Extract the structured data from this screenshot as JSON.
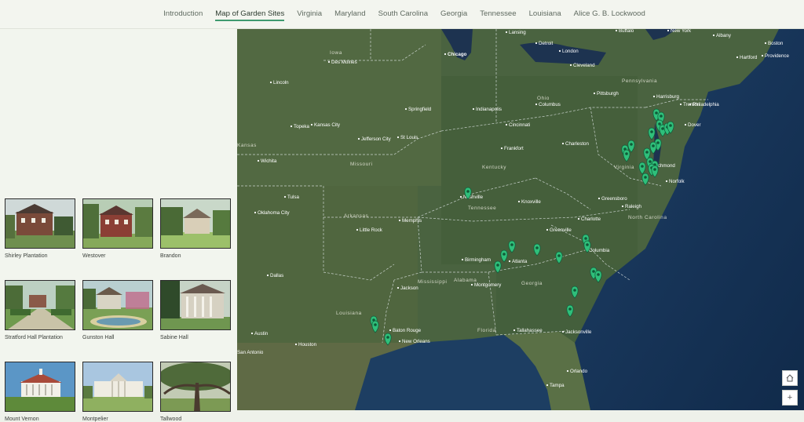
{
  "nav": {
    "tabs": [
      "Introduction",
      "Map of Garden Sites",
      "Virginia",
      "Maryland",
      "South Carolina",
      "Georgia",
      "Tennessee",
      "Louisiana",
      "Alice G. B. Lockwood"
    ],
    "active_index": 1
  },
  "gallery": [
    {
      "caption": "Shirley Plantation"
    },
    {
      "caption": "Westover"
    },
    {
      "caption": "Brandon"
    },
    {
      "caption": "Stratford Hall Plantation"
    },
    {
      "caption": "Gunston Hall"
    },
    {
      "caption": "Sabine Hall"
    },
    {
      "caption": "Mount Vernon"
    },
    {
      "caption": "Montpelier"
    },
    {
      "caption": "Tallwood"
    }
  ],
  "map": {
    "cities": [
      "Chicago",
      "Lansing",
      "Detroit",
      "London",
      "Buffalo",
      "New York",
      "Albany",
      "Boston",
      "Hartford",
      "Providence",
      "Iowa",
      "Des Moines",
      "Cleveland",
      "Pennsylvania",
      "Pittsburgh",
      "Harrisburg",
      "Trenton",
      "Philadelphia",
      "Lincoln",
      "Springfield",
      "Ohio",
      "Columbus",
      "Indianapolis",
      "Cincinnati",
      "Dover",
      "Topeka",
      "Kansas City",
      "Jefferson City",
      "St Louis",
      "Frankfort",
      "Charleston",
      "Kansas",
      "Wichita",
      "Missouri",
      "Kentucky",
      "Virginia",
      "Richmond",
      "Norfolk",
      "Nashville",
      "Knoxville",
      "Tennessee",
      "Greensboro",
      "Raleigh",
      "North Carolina",
      "Tulsa",
      "Oklahoma City",
      "Arkansas",
      "Memphis",
      "Charlotte",
      "Greenville",
      "Columbia",
      "Little Rock",
      "Birmingham",
      "Atlanta",
      "Dallas",
      "Mississippi",
      "Alabama",
      "Georgia",
      "Jackson",
      "Montgomery",
      "Louisiana",
      "Austin",
      "Houston",
      "San Antonio",
      "Baton Rouge",
      "New Orleans",
      "Florida",
      "Tallahassee",
      "Jacksonville",
      "Orlando",
      "Tampa"
    ],
    "marker_count": 34,
    "marker_color": "#2fbf7a",
    "controls": {
      "home": "home-icon",
      "zoom_in": "+"
    }
  }
}
